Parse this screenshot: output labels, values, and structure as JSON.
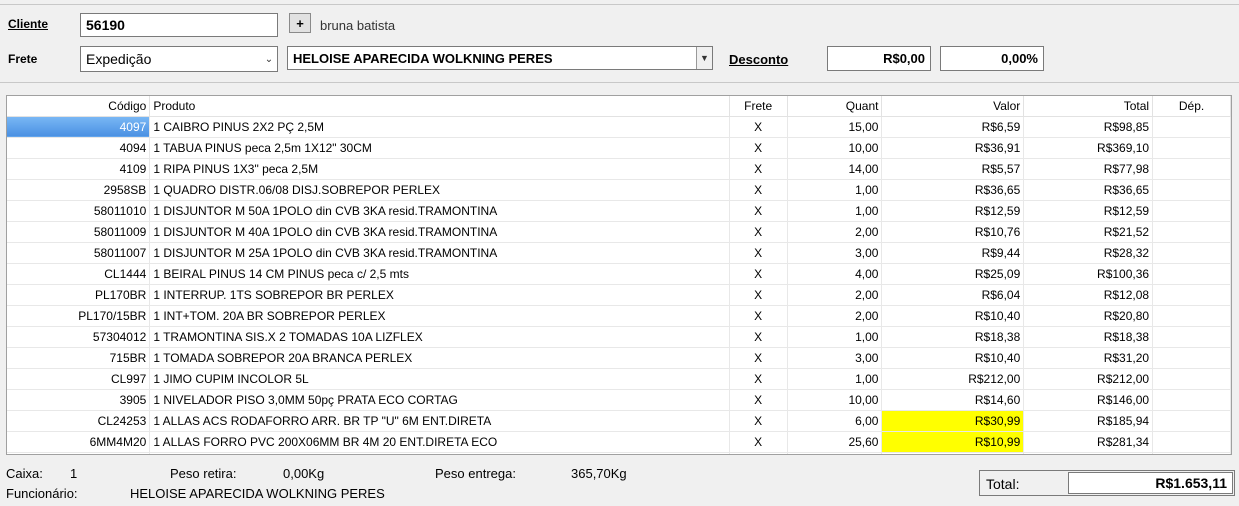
{
  "top": {
    "cliente_label": "Cliente",
    "cliente_value": "56190",
    "add_button": "+",
    "cliente_nome": "bruna batista",
    "frete_label": "Frete",
    "frete_value": "Expedição",
    "vendedor_value": "HELOISE APARECIDA WOLKNING PERES",
    "desconto_label": "Desconto",
    "desconto_valor": "R$0,00",
    "desconto_percent": "0,00%"
  },
  "grid": {
    "columns": [
      "Código",
      "Produto",
      "Frete",
      "Quant",
      "Valor",
      "Total",
      "Dép."
    ],
    "rows": [
      {
        "codigo": "4097",
        "produto": "1 CAIBRO PINUS 2X2 PÇ 2,5M",
        "frete": "X",
        "quant": "15,00",
        "valor": "R$6,59",
        "total": "R$98,85",
        "dep": "",
        "selected": true,
        "highlight": false
      },
      {
        "codigo": "4094",
        "produto": "1 TABUA PINUS peca 2,5m 1X12\" 30CM",
        "frete": "X",
        "quant": "10,00",
        "valor": "R$36,91",
        "total": "R$369,10",
        "dep": "",
        "selected": false,
        "highlight": false
      },
      {
        "codigo": "4109",
        "produto": "1 RIPA PINUS 1X3\" peca 2,5M",
        "frete": "X",
        "quant": "14,00",
        "valor": "R$5,57",
        "total": "R$77,98",
        "dep": "",
        "selected": false,
        "highlight": false
      },
      {
        "codigo": "2958SB",
        "produto": "1 QUADRO DISTR.06/08 DISJ.SOBREPOR PERLEX",
        "frete": "X",
        "quant": "1,00",
        "valor": "R$36,65",
        "total": "R$36,65",
        "dep": "",
        "selected": false,
        "highlight": false
      },
      {
        "codigo": "58011010",
        "produto": "1 DISJUNTOR M 50A 1POLO din CVB 3KA resid.TRAMONTINA",
        "frete": "X",
        "quant": "1,00",
        "valor": "R$12,59",
        "total": "R$12,59",
        "dep": "",
        "selected": false,
        "highlight": false
      },
      {
        "codigo": "58011009",
        "produto": "1 DISJUNTOR M 40A 1POLO din CVB 3KA resid.TRAMONTINA",
        "frete": "X",
        "quant": "2,00",
        "valor": "R$10,76",
        "total": "R$21,52",
        "dep": "",
        "selected": false,
        "highlight": false
      },
      {
        "codigo": "58011007",
        "produto": "1 DISJUNTOR M 25A 1POLO din CVB 3KA resid.TRAMONTINA",
        "frete": "X",
        "quant": "3,00",
        "valor": "R$9,44",
        "total": "R$28,32",
        "dep": "",
        "selected": false,
        "highlight": false
      },
      {
        "codigo": "CL1444",
        "produto": "1 BEIRAL PINUS 14 CM PINUS peca c/ 2,5 mts",
        "frete": "X",
        "quant": "4,00",
        "valor": "R$25,09",
        "total": "R$100,36",
        "dep": "",
        "selected": false,
        "highlight": false
      },
      {
        "codigo": "PL170BR",
        "produto": "1 INTERRUP. 1TS SOBREPOR BR PERLEX",
        "frete": "X",
        "quant": "2,00",
        "valor": "R$6,04",
        "total": "R$12,08",
        "dep": "",
        "selected": false,
        "highlight": false
      },
      {
        "codigo": "PL170/15BR",
        "produto": "1 INT+TOM. 20A BR SOBREPOR PERLEX",
        "frete": "X",
        "quant": "2,00",
        "valor": "R$10,40",
        "total": "R$20,80",
        "dep": "",
        "selected": false,
        "highlight": false
      },
      {
        "codigo": "57304012",
        "produto": "1 TRAMONTINA SIS.X 2 TOMADAS 10A LIZFLEX",
        "frete": "X",
        "quant": "1,00",
        "valor": "R$18,38",
        "total": "R$18,38",
        "dep": "",
        "selected": false,
        "highlight": false
      },
      {
        "codigo": "715BR",
        "produto": "1 TOMADA SOBREPOR 20A BRANCA PERLEX",
        "frete": "X",
        "quant": "3,00",
        "valor": "R$10,40",
        "total": "R$31,20",
        "dep": "",
        "selected": false,
        "highlight": false
      },
      {
        "codigo": "CL997",
        "produto": "1 JIMO CUPIM INCOLOR 5L",
        "frete": "X",
        "quant": "1,00",
        "valor": "R$212,00",
        "total": "R$212,00",
        "dep": "",
        "selected": false,
        "highlight": false
      },
      {
        "codigo": "3905",
        "produto": "1 NIVELADOR PISO 3,0MM 50pç PRATA ECO CORTAG",
        "frete": "X",
        "quant": "10,00",
        "valor": "R$14,60",
        "total": "R$146,00",
        "dep": "",
        "selected": false,
        "highlight": false
      },
      {
        "codigo": "CL24253",
        "produto": "1 ALLAS ACS RODAFORRO ARR. BR TP \"U\" 6M ENT.DIRETA",
        "frete": "X",
        "quant": "6,00",
        "valor": "R$30,99",
        "total": "R$185,94",
        "dep": "",
        "selected": false,
        "highlight": true
      },
      {
        "codigo": "6MM4M20",
        "produto": "1 ALLAS FORRO PVC 200X06MM BR 4M 20 ENT.DIRETA ECO",
        "frete": "X",
        "quant": "25,60",
        "valor": "R$10,99",
        "total": "R$281,34",
        "dep": "",
        "selected": false,
        "highlight": true
      }
    ]
  },
  "status": {
    "caixa_label": "Caixa:",
    "caixa_value": "1",
    "peso_retira_label": "Peso retira:",
    "peso_retira_value": "0,00Kg",
    "peso_entrega_label": "Peso entrega:",
    "peso_entrega_value": "365,70Kg",
    "funcionario_label": "Funcionário:",
    "funcionario_value": "HELOISE APARECIDA WOLKNING PERES",
    "total_label": "Total:",
    "total_value": "R$1.653,11"
  },
  "colors": {
    "highlight": "#ffff00",
    "selection": "#4a90e2"
  }
}
